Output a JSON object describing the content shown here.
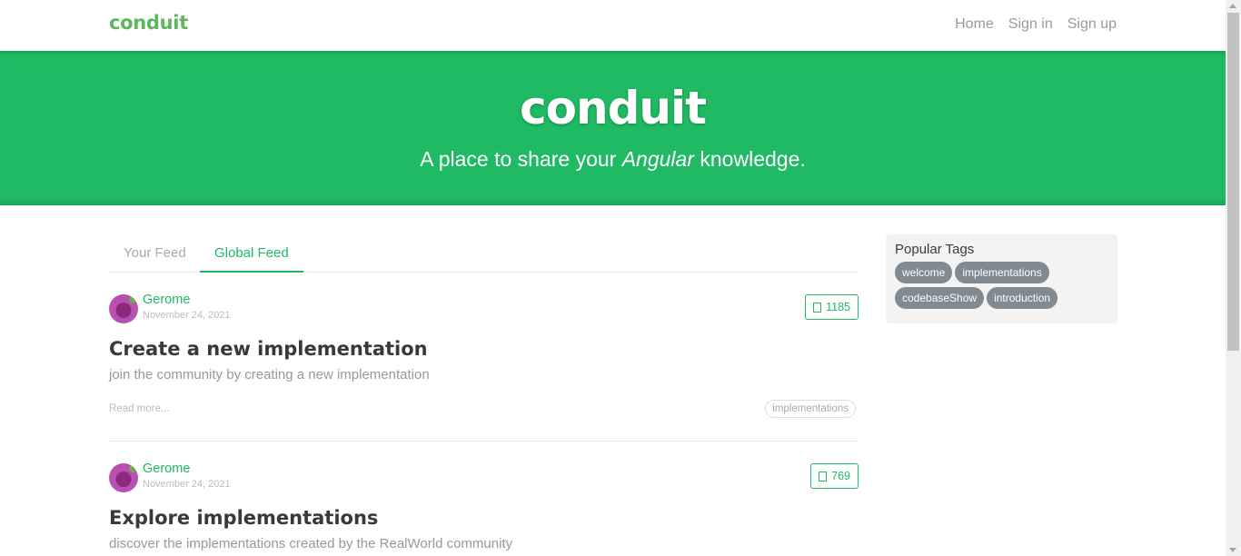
{
  "nav": {
    "brand": "conduit",
    "links": [
      "Home",
      "Sign in",
      "Sign up"
    ]
  },
  "banner": {
    "title": "conduit",
    "subtitle_before": "A place to share your ",
    "subtitle_emphasis": "Angular",
    "subtitle_after": " knowledge."
  },
  "feed": {
    "tabs": [
      "Your Feed",
      "Global Feed"
    ],
    "active_tab": "Global Feed"
  },
  "articles": [
    {
      "author": "Gerome",
      "date": "November 24, 2021",
      "favorites": "1185",
      "title": "Create a new implementation",
      "description": "join the community by creating a new implementation",
      "read_more": "Read more...",
      "tags": [
        "implementations"
      ]
    },
    {
      "author": "Gerome",
      "date": "November 24, 2021",
      "favorites": "769",
      "title": "Explore implementations",
      "description": "discover the implementations created by the RealWorld community"
    }
  ],
  "sidebar": {
    "title": "Popular Tags",
    "tags": [
      "welcome",
      "implementations",
      "codebaseShow",
      "introduction"
    ]
  },
  "colors": {
    "brand": "#1fba63",
    "tag_bg": "#818a91"
  },
  "icons": {
    "favorite": "heart-icon",
    "avatar": "user-avatar"
  }
}
